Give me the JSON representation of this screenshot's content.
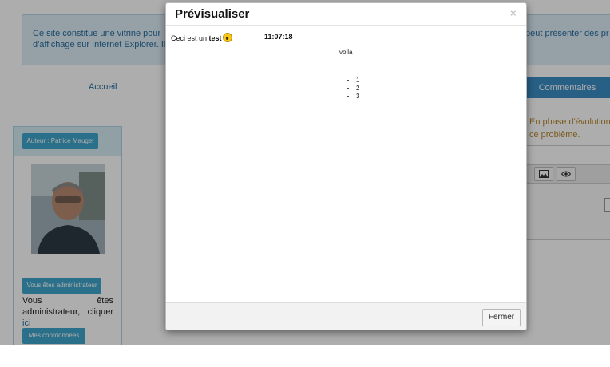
{
  "background": {
    "alert": {
      "line1": "Ce site constitue une vitrine pour le",
      "line2": "d'affichage sur Internet Explorer. Il c",
      "right_line1": "peut présenter des pr"
    },
    "nav": {
      "home": "Accueil"
    },
    "tabs": {
      "comments": "Commentaires"
    },
    "notice": {
      "line1": "En phase d'évolution",
      "line2": "ce problème."
    },
    "editor": {
      "toolbar_icons": [
        "image-icon",
        "eye-icon"
      ]
    }
  },
  "sidebar": {
    "author_button": "Auteur : Patrice Mauget",
    "admin_button": "Vous êtes administrateur",
    "admin_text": "Vous êtes administrateur, cliquer",
    "admin_link": "ici",
    "coords_button": "Mes coordonnées"
  },
  "modal": {
    "title": "Prévisualiser",
    "close_glyph": "×",
    "content": {
      "prefix": "Ceci est un",
      "bold": "test",
      "emoji": "surprised-face-icon",
      "time": "11:07:18",
      "centered": "voila",
      "list": [
        "1",
        "2",
        "3"
      ]
    },
    "footer": {
      "close_button": "Fermer"
    }
  },
  "colors": {
    "accent": "#3c8dc5",
    "button": "#3fa6cc",
    "alert_bg": "#dcecf6",
    "notice_text": "#b8862a",
    "overlay": "rgba(0,0,0,0.32)"
  }
}
